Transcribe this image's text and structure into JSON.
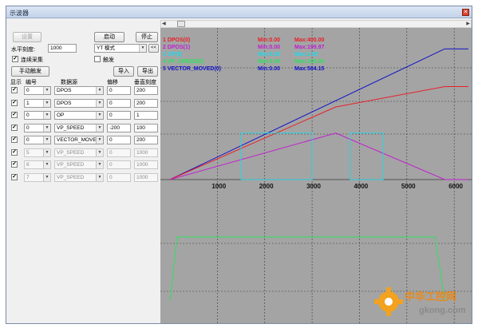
{
  "window": {
    "title": "示波器"
  },
  "controls": {
    "settings_label": "设置",
    "start_label": "启动",
    "stop_label": "停止",
    "h_scale_label": "水平刻度:",
    "h_scale_value": "1000",
    "mode_value": "YT 模式",
    "mode_arrow_label": "<<",
    "continuous_label": "连续采集",
    "continuous_checked": true,
    "trigger_label": "触发",
    "trigger_checked": false,
    "manual_trigger_label": "手动触发",
    "import_label": "导入",
    "export_label": "导出"
  },
  "channel_table": {
    "headers": [
      "显示",
      "编号",
      "数据源",
      "偏移",
      "垂直刻度"
    ],
    "rows": [
      {
        "show": true,
        "num": "0",
        "src": "DPOS",
        "offset": "0",
        "scale": "200",
        "enabled": true
      },
      {
        "show": true,
        "num": "1",
        "src": "DPOS",
        "offset": "0",
        "scale": "200",
        "enabled": true
      },
      {
        "show": true,
        "num": "0",
        "src": "OP",
        "offset": "0",
        "scale": "1",
        "enabled": true
      },
      {
        "show": true,
        "num": "0",
        "src": "VP_SPEED",
        "offset": "-200",
        "scale": "100",
        "enabled": true
      },
      {
        "show": true,
        "num": "0",
        "src": "VECTOR_MOVED",
        "offset": "0",
        "scale": "200",
        "enabled": true
      },
      {
        "show": true,
        "num": "5",
        "src": "VP_SPEED",
        "offset": "0",
        "scale": "1000",
        "enabled": false
      },
      {
        "show": true,
        "num": "6",
        "src": "VP_SPEED",
        "offset": "0",
        "scale": "1000",
        "enabled": false
      },
      {
        "show": true,
        "num": "7",
        "src": "VP_SPEED",
        "offset": "0",
        "scale": "1000",
        "enabled": false
      }
    ]
  },
  "legend": [
    {
      "label": "1 DPOS(0)",
      "min": "Min:0.00",
      "max": "Max:400.00",
      "color": "#e8202a"
    },
    {
      "label": "2 DPOS(1)",
      "min": "Min:0.00",
      "max": "Max:199.97",
      "color": "#c020d0"
    },
    {
      "label": "3 OP(0)",
      "min": "Min:0.00",
      "max": "Max:1.00",
      "color": "#22d8e8"
    },
    {
      "label": "4 VP_SPEED(0)",
      "min": "Min:0.00",
      "max": "Max:100.00",
      "color": "#2ee060"
    },
    {
      "label": "5 VECTOR_MOVED(0)",
      "min": "Min:0.00",
      "max": "Max:584.15",
      "color": "#1010c8"
    }
  ],
  "x_ticks": [
    "1000",
    "2000",
    "3000",
    "4000",
    "5000",
    "6000"
  ],
  "colors": {
    "plot_bg": "#a4a4a4",
    "grid": "#3a3a3a",
    "title_accent": "#d9412c"
  },
  "chart_data": {
    "type": "line",
    "x_range": [
      0,
      6300
    ],
    "x_ticks": [
      1000,
      2000,
      3000,
      4000,
      5000,
      6000
    ],
    "series": [
      {
        "name": "1 DPOS(0)",
        "points": [
          [
            0,
            0
          ],
          [
            3500,
            0.5
          ],
          [
            5800,
            0.64
          ],
          [
            6300,
            0.64
          ]
        ]
      },
      {
        "name": "2 DPOS(1)",
        "points": [
          [
            0,
            0
          ],
          [
            3500,
            0.32
          ],
          [
            5800,
            0
          ],
          [
            6300,
            0
          ]
        ]
      },
      {
        "name": "3 OP(0)",
        "pulses": [
          [
            1500,
            3000
          ],
          [
            3800,
            4500
          ]
        ]
      },
      {
        "name": "4 VP_SPEED(0)",
        "points": [
          [
            0,
            0
          ],
          [
            150,
            1
          ],
          [
            5600,
            1
          ],
          [
            5800,
            0
          ]
        ]
      },
      {
        "name": "5 VECTOR_MOVED(0)",
        "points": [
          [
            0,
            0
          ],
          [
            5800,
            0.9
          ],
          [
            6300,
            0.9
          ]
        ]
      }
    ]
  },
  "watermark": {
    "cn": "中华工控网",
    "url": "gkong.com"
  }
}
